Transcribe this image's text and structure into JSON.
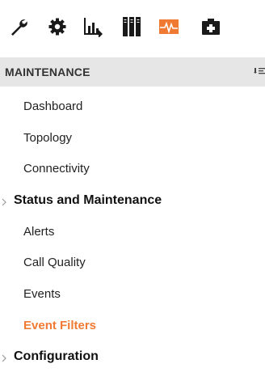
{
  "toolbar": {
    "icons": [
      {
        "name": "wrench-icon"
      },
      {
        "name": "gear-icon"
      },
      {
        "name": "bar-chart-icon"
      },
      {
        "name": "server-rack-icon"
      },
      {
        "name": "activity-icon",
        "accent": "#f07a33"
      },
      {
        "name": "briefcase-icon"
      }
    ]
  },
  "sidebar": {
    "section_title": "MAINTENANCE",
    "items": [
      {
        "label": "Dashboard",
        "type": "item"
      },
      {
        "label": "Topology",
        "type": "item"
      },
      {
        "label": "Connectivity",
        "type": "item"
      },
      {
        "label": "Status and Maintenance",
        "type": "group"
      },
      {
        "label": "Alerts",
        "type": "item"
      },
      {
        "label": "Call Quality",
        "type": "item"
      },
      {
        "label": "Events",
        "type": "item"
      },
      {
        "label": "Event Filters",
        "type": "item",
        "active": true
      },
      {
        "label": "Configuration",
        "type": "group"
      }
    ]
  },
  "colors": {
    "accent": "#f07a33",
    "header_bg": "#e6e6e6",
    "text": "#222222"
  }
}
